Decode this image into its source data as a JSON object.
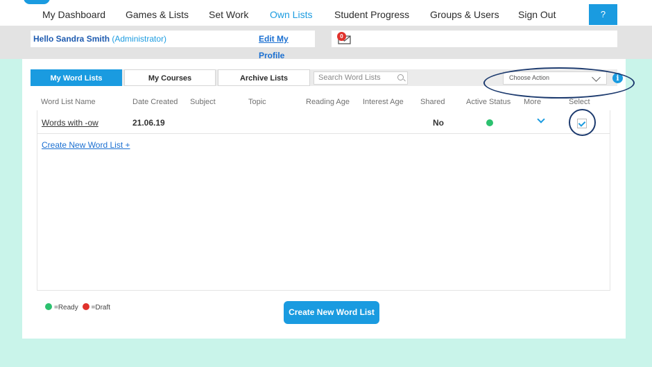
{
  "nav": {
    "items": [
      {
        "label": "My Dashboard"
      },
      {
        "label": "Games & Lists"
      },
      {
        "label": "Set Work"
      },
      {
        "label": "Own Lists"
      },
      {
        "label": "Student Progress"
      },
      {
        "label": "Groups & Users"
      },
      {
        "label": "Sign Out"
      }
    ],
    "active": "Own Lists",
    "help_label": "?"
  },
  "hello": {
    "greeting": "Hello Sandra Smith",
    "role": "(Administrator)",
    "edit_profile": "Edit My Profile",
    "message_count": "0"
  },
  "tabs": [
    {
      "label": "My Word Lists",
      "active": true
    },
    {
      "label": "My Courses",
      "active": false
    },
    {
      "label": "Archive Lists",
      "active": false
    }
  ],
  "search": {
    "placeholder": "Search Word Lists"
  },
  "action": {
    "label": "Choose Action",
    "info": "i"
  },
  "table": {
    "columns": [
      "Word List Name",
      "Date Created",
      "Subject",
      "Topic",
      "Reading Age",
      "Interest Age",
      "Shared",
      "Active Status",
      "More",
      "Select"
    ],
    "rows": [
      {
        "name": "Words with -ow",
        "date": "21.06.19",
        "subject": "",
        "topic": "",
        "reading_age": "",
        "interest_age": "",
        "shared": "No",
        "active_status": "Ready",
        "selected": true
      }
    ]
  },
  "create_link": "Create New Word List +",
  "legend": {
    "ready": "=Ready",
    "draft": "=Draft"
  },
  "create_button": "Create New Word List",
  "colors": {
    "accent": "#1a9be0",
    "ready": "#2cc16f",
    "draft": "#e0322c",
    "background": "#c9f4ea",
    "annotation": "#1c3a6e"
  }
}
